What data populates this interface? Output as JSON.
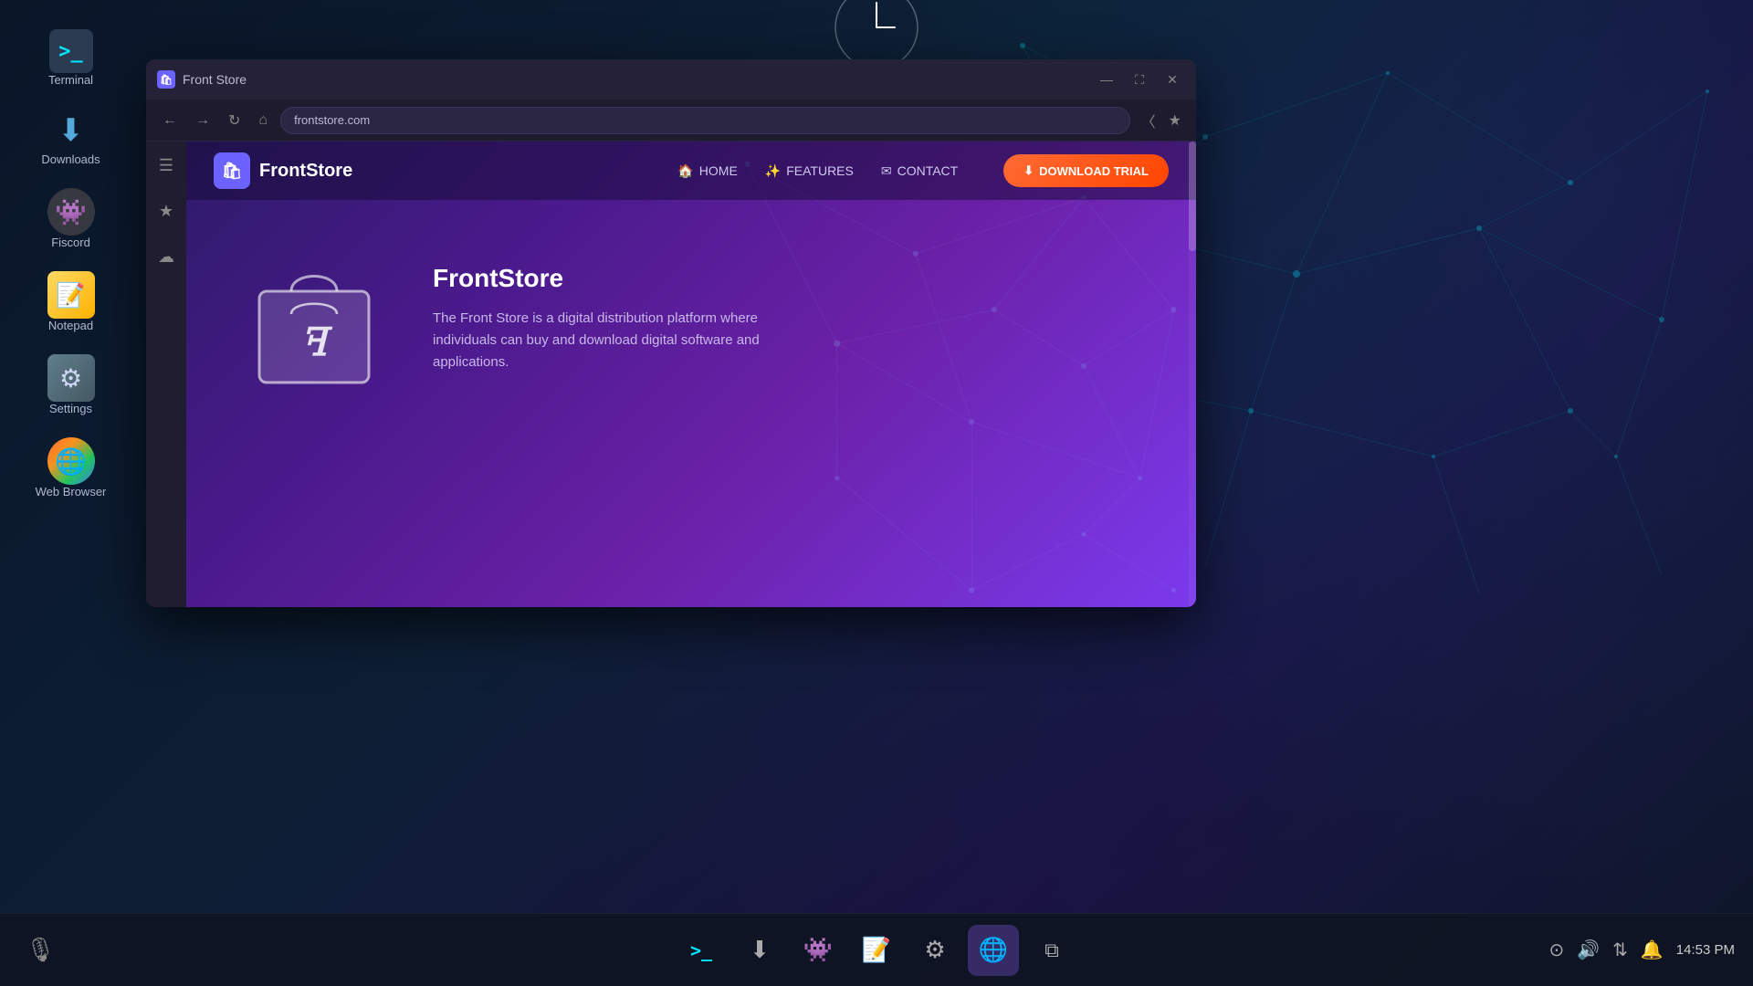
{
  "desktop": {
    "background_color": "#0d1628"
  },
  "sidebar_apps": [
    {
      "id": "terminal",
      "label": "Terminal",
      "icon": ">_"
    },
    {
      "id": "downloads",
      "label": "Downloads",
      "icon": "⬇"
    },
    {
      "id": "fiscord",
      "label": "Fiscord",
      "icon": "👾"
    },
    {
      "id": "notepad",
      "label": "Notepad",
      "icon": "📝"
    },
    {
      "id": "settings",
      "label": "Settings",
      "icon": "⚙"
    },
    {
      "id": "webbrowser",
      "label": "Web Browser",
      "icon": "🌐"
    }
  ],
  "browser": {
    "title": "Front Store",
    "favicon": "🛍",
    "url": "frontstore.com",
    "window_controls": {
      "minimize": "—",
      "maximize": "⛶",
      "close": "✕"
    },
    "sidebar_icons": [
      "☰",
      "★",
      "☁"
    ]
  },
  "website": {
    "logo_icon": "🛍",
    "logo_text": "FrontStore",
    "nav": {
      "home_icon": "🏠",
      "home_label": "HOME",
      "features_icon": "✨",
      "features_label": "FEATURES",
      "contact_icon": "✉",
      "contact_label": "CONTACT"
    },
    "cta_icon": "⬇",
    "cta_label": "DOWNLOAD TRIAL",
    "hero": {
      "title": "FrontStore",
      "description": "The Front Store is a digital distribution platform where individuals can buy and download digital software and applications."
    }
  },
  "taskbar": {
    "time": "14:53 PM",
    "apps": [
      {
        "id": "terminal",
        "icon": ">_",
        "active": false
      },
      {
        "id": "downloads",
        "icon": "⬇",
        "active": false
      },
      {
        "id": "fiscord",
        "icon": "👾",
        "active": false
      },
      {
        "id": "notepad",
        "icon": "📝",
        "active": false
      },
      {
        "id": "settings",
        "icon": "⚙",
        "active": false
      },
      {
        "id": "webbrowser",
        "icon": "🌐",
        "active": true
      },
      {
        "id": "multitask",
        "icon": "⧉",
        "active": false
      }
    ],
    "right_icons": [
      "⊙",
      "🔊",
      "⇅",
      "🔔"
    ]
  }
}
